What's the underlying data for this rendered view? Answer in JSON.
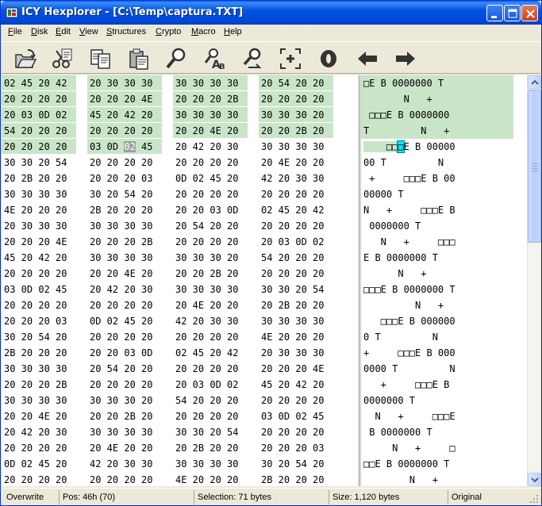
{
  "window": {
    "title": "ICY Hexplorer - [C:\\Temp\\captura.TXT]",
    "colors": {
      "titlebar": "#0054E3",
      "selection": "#C9E5C7",
      "caret_ascii": "#00E5FF",
      "caret_hex": "#A0A0A0"
    }
  },
  "menu": {
    "items": [
      {
        "label": "File",
        "name": "menu-file"
      },
      {
        "label": "Disk",
        "name": "menu-disk"
      },
      {
        "label": "Edit",
        "name": "menu-edit"
      },
      {
        "label": "View",
        "name": "menu-view"
      },
      {
        "label": "Structures",
        "name": "menu-structures"
      },
      {
        "label": "Crypto",
        "name": "menu-crypto"
      },
      {
        "label": "Macro",
        "name": "menu-macro"
      },
      {
        "label": "Help",
        "name": "menu-help"
      }
    ]
  },
  "toolbar": {
    "buttons": [
      {
        "icon": "open-folder-icon"
      },
      {
        "icon": "cut-icon"
      },
      {
        "icon": "copy-icon"
      },
      {
        "icon": "paste-icon"
      },
      {
        "icon": "find-icon"
      },
      {
        "icon": "replace-icon"
      },
      {
        "icon": "find-next-icon"
      },
      {
        "icon": "goto-offset-icon"
      },
      {
        "icon": "zero-icon"
      },
      {
        "icon": "back-arrow-icon"
      },
      {
        "icon": "forward-arrow-icon"
      }
    ]
  },
  "hex": {
    "rows": [
      [
        "02 45 20 42",
        "20 30 30 30",
        "30 30 30 30",
        "20 54 20 20"
      ],
      [
        "20 20 20 20",
        "20 20 20 4E",
        "20 20 20 2B",
        "20 20 20 20"
      ],
      [
        "20 03 0D 02",
        "45 20 42 20",
        "30 30 30 30",
        "30 30 30 20"
      ],
      [
        "54 20 20 20",
        "20 20 20 20",
        "20 20 4E 20",
        "20 20 2B 20"
      ],
      [
        "20 20 20 20",
        "03 0D 02 45",
        "20 42 20 30",
        "30 30 30 30"
      ],
      [
        "30 30 20 54",
        "20 20 20 20",
        "20 20 20 20",
        "20 4E 20 20"
      ],
      [
        "20 2B 20 20",
        "20 20 20 03",
        "0D 02 45 20",
        "42 20 30 30"
      ],
      [
        "30 30 30 30",
        "30 20 54 20",
        "20 20 20 20",
        "20 20 20 20"
      ],
      [
        "4E 20 20 20",
        "2B 20 20 20",
        "20 20 03 0D",
        "02 45 20 42"
      ],
      [
        "20 30 30 30",
        "30 30 30 30",
        "20 54 20 20",
        "20 20 20 20"
      ],
      [
        "20 20 20 4E",
        "20 20 20 2B",
        "20 20 20 20",
        "20 03 0D 02"
      ],
      [
        "45 20 42 20",
        "30 30 30 30",
        "30 30 30 20",
        "54 20 20 20"
      ],
      [
        "20 20 20 20",
        "20 20 4E 20",
        "20 20 2B 20",
        "20 20 20 20"
      ],
      [
        "03 0D 02 45",
        "20 42 20 30",
        "30 30 30 30",
        "30 30 20 54"
      ],
      [
        "20 20 20 20",
        "20 20 20 20",
        "20 4E 20 20",
        "20 2B 20 20"
      ],
      [
        "20 20 20 03",
        "0D 02 45 20",
        "42 20 30 30",
        "30 30 30 30"
      ],
      [
        "30 20 54 20",
        "20 20 20 20",
        "20 20 20 20",
        "4E 20 20 20"
      ],
      [
        "2B 20 20 20",
        "20 20 03 0D",
        "02 45 20 42",
        "20 30 30 30"
      ],
      [
        "30 30 30 30",
        "20 54 20 20",
        "20 20 20 20",
        "20 20 20 4E"
      ],
      [
        "20 20 20 2B",
        "20 20 20 20",
        "20 03 0D 02",
        "45 20 42 20"
      ],
      [
        "30 30 30 30",
        "30 30 30 20",
        "54 20 20 20",
        "20 20 20 20"
      ],
      [
        "20 20 4E 20",
        "20 20 2B 20",
        "20 20 20 20",
        "03 0D 02 45"
      ],
      [
        "20 42 20 30",
        "30 30 30 30",
        "30 30 20 54",
        "20 20 20 20"
      ],
      [
        "20 20 20 20",
        "20 4E 20 20",
        "20 2B 20 20",
        "20 20 20 03"
      ],
      [
        "0D 02 45 20",
        "42 20 30 30",
        "30 30 30 30",
        "30 20 54 20"
      ],
      [
        "20 20 20 20",
        "20 20 20 20",
        "4E 20 20 20",
        "2B 20 20 20"
      ]
    ],
    "caret_byte": "02"
  },
  "ascii": {
    "rows": [
      "□E B 0000000 T  ",
      "       N   +    ",
      " □□□E B 0000000 ",
      "T         N   + ",
      "    □□□E B 00000",
      "00 T         N  ",
      " +     □□□E B 00",
      "00000 T         ",
      "N   +     □□□E B",
      " 0000000 T      ",
      "   N   +     □□□",
      "E B 0000000 T   ",
      "      N   +     ",
      "□□□E B 0000000 T",
      "         N   +  ",
      "   □□□E B 000000",
      "0 T         N   ",
      "+     □□□E B 000",
      "0000 T         N",
      "   +     □□□E B ",
      "0000000 T       ",
      "  N   +     □□□E",
      " B 0000000 T    ",
      "     N   +     □",
      "□□E B 0000000 T ",
      "        N   +   "
    ]
  },
  "status": {
    "mode": "Overwrite",
    "pos": "Pos: 46h (70)",
    "selection": "Selection: 71 bytes",
    "size": "Size: 1,120 bytes",
    "state": "Original"
  }
}
